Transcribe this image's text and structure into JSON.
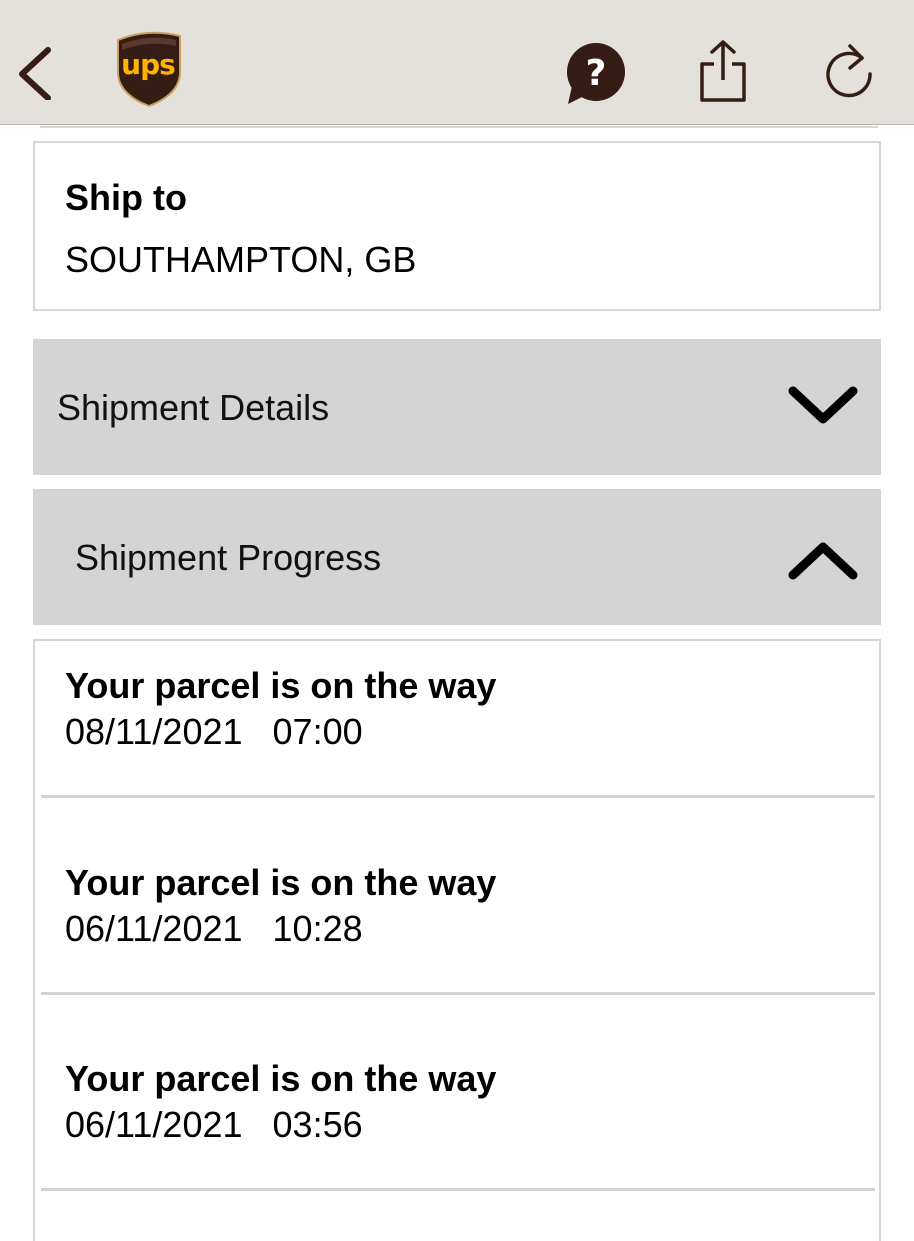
{
  "nav": {
    "back_icon": "chevron-left-icon",
    "logo_text": "ups",
    "help_icon": "help-bubble-icon",
    "share_icon": "share-icon",
    "refresh_icon": "refresh-icon",
    "brand_brown": "#351c15",
    "brand_gold": "#ffb500",
    "bar_color": "#e4e1dd"
  },
  "ship_to": {
    "label": "Ship to",
    "value": "SOUTHAMPTON, GB"
  },
  "sections": {
    "details": {
      "label": "Shipment Details",
      "state": "collapsed",
      "icon": "chevron-down-icon"
    },
    "progress": {
      "label": "Shipment Progress",
      "state": "expanded",
      "icon": "chevron-up-icon"
    }
  },
  "events": [
    {
      "title": "Your parcel is on the way",
      "date": "08/11/2021",
      "time": "07:00"
    },
    {
      "title": "Your parcel is on the way",
      "date": "06/11/2021",
      "time": "10:28"
    },
    {
      "title": "Your parcel is on the way",
      "date": "06/11/2021",
      "time": "03:56"
    }
  ]
}
